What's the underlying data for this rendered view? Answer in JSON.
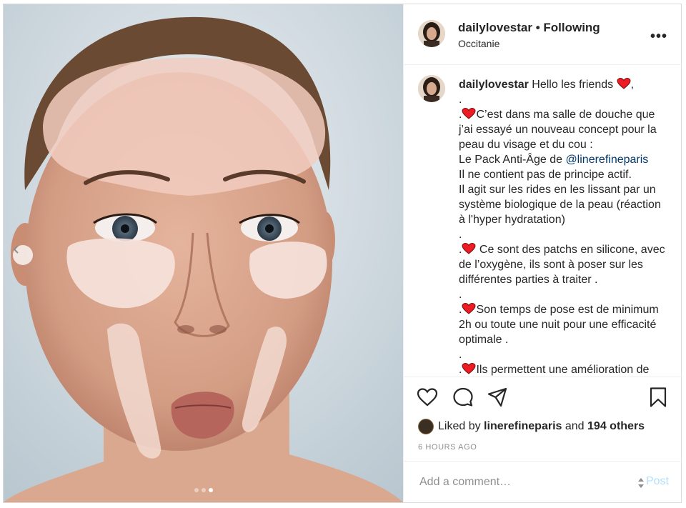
{
  "post": {
    "username": "dailylovestar",
    "separator": "•",
    "follow_label": "Following",
    "location": "Occitanie",
    "more_label": "•••"
  },
  "caption": {
    "username": "dailylovestar",
    "intro": "Hello les friends",
    "intro_end": ",",
    "line_dot1": ".",
    "p1_prefix": ".",
    "p1": "C’est dans ma salle de douche que j’ai essayé un nouveau concept pour la peau du visage et du cou :",
    "p1b_prefix": "Le Pack Anti-Âge de ",
    "mention": "@linerefineparis",
    "p1c": "Il ne contient pas de principe actif.",
    "p1d": "Il agit sur les rides en les lissant par un système biologique de la peau (réaction à l'hyper hydratation)",
    "line_dot2": ".",
    "p2_prefix": ".",
    "p2": " Ce sont des patchs en silicone, avec de l’oxygène, ils sont à poser sur les différentes parties à traiter .",
    "line_dot3": ".",
    "p3_prefix": ".",
    "p3": "Son temps de pose est de minimum 2h ou toute une nuit pour une efficacité optimale .",
    "line_dot4": ".",
    "p4_prefix": ".",
    "p4": "Ils permettent une amélioration de"
  },
  "actions": {
    "like_icon": "heart-outline-icon",
    "comment_icon": "comment-icon",
    "share_icon": "send-icon",
    "save_icon": "bookmark-icon"
  },
  "likes": {
    "prefix": "Liked by",
    "user": "linerefineparis",
    "middle": "and",
    "others": "194 others"
  },
  "timestamp": "6 HOURS AGO",
  "comment": {
    "placeholder": "Add a comment…",
    "post_label": "Post"
  },
  "carousel": {
    "count": 3,
    "active_index": 2
  },
  "colors": {
    "link": "#00376b",
    "post_disabled": "#b2dffc",
    "meta": "#8e8e8e",
    "heart_red": "#ed1c24"
  }
}
